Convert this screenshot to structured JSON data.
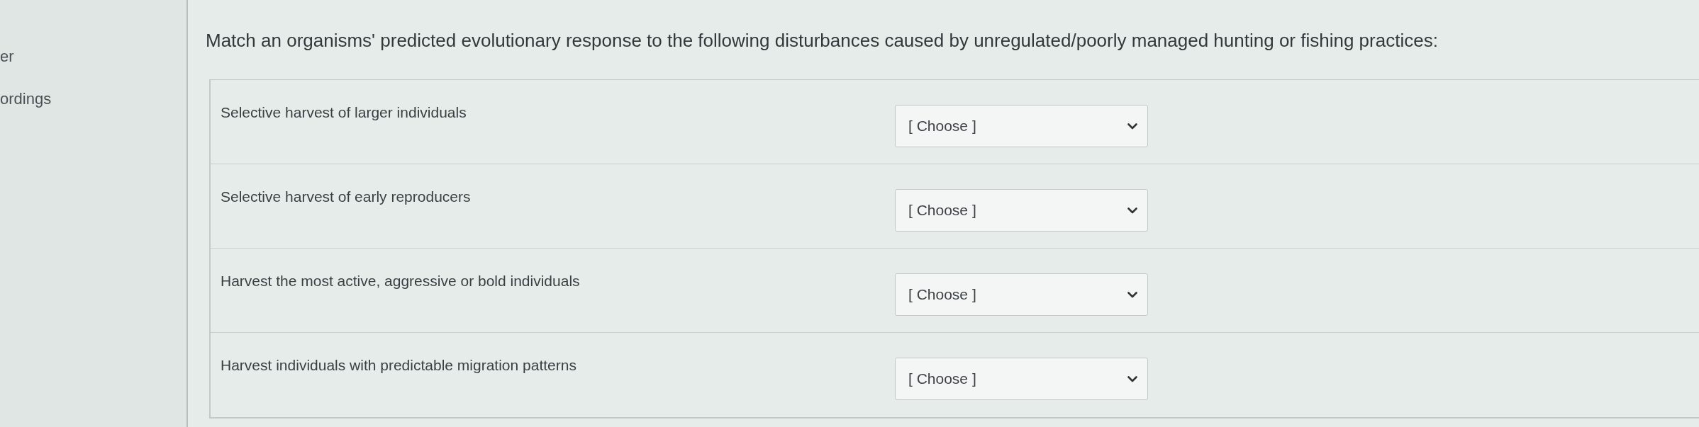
{
  "sidebar": {
    "items": [
      {
        "label": "er"
      },
      {
        "label": "ordings"
      }
    ]
  },
  "question": {
    "prompt": "Match an organisms' predicted evolutionary response to the following disturbances caused by unregulated/poorly managed hunting or fishing practices:",
    "matches": [
      {
        "label": "Selective harvest of larger individuals",
        "dropdown": {
          "value": "[ Choose ]"
        }
      },
      {
        "label": "Selective harvest of early reproducers",
        "dropdown": {
          "value": "[ Choose ]"
        }
      },
      {
        "label": "Harvest the most active, aggressive or bold individuals",
        "dropdown": {
          "value": "[ Choose ]"
        }
      },
      {
        "label": "Harvest individuals with predictable migration patterns",
        "dropdown": {
          "value": "[ Choose ]"
        }
      }
    ]
  }
}
